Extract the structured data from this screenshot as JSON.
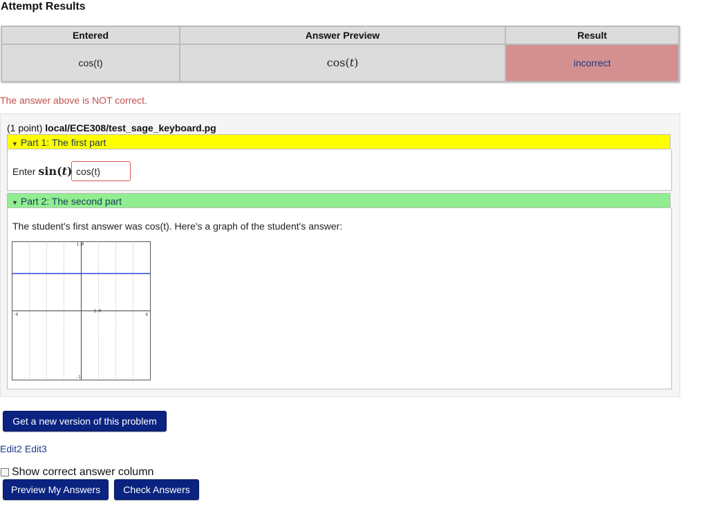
{
  "title": "Attempt Results",
  "results": {
    "headers": [
      "Entered",
      "Answer Preview",
      "Result"
    ],
    "row": {
      "entered": "cos(t)",
      "preview_func": "cos",
      "preview_var": "t",
      "result": "incorrect"
    }
  },
  "feedback": "The answer above is NOT correct.",
  "problem": {
    "points": "(1 point)",
    "path": "local/ECE308/test_sage_keyboard.pg",
    "part1": {
      "header": "Part 1: The first part",
      "enter_label": "Enter",
      "math_func": "sin",
      "math_var": "t",
      "input_value": "cos(t)"
    },
    "part2": {
      "header": "Part 2: The second part",
      "text": "The student's first answer was cos(t). Here's a graph of the student's answer:"
    }
  },
  "chart_data": {
    "type": "line",
    "series": [
      {
        "x": [
          -4,
          4
        ],
        "values": [
          0.54,
          0.54
        ]
      }
    ],
    "xlim": [
      -4,
      4
    ],
    "ylim": [
      -1,
      1
    ],
    "tick_labels": {
      "y_top": "1.0",
      "y_bottom": "-1",
      "x_left": "-4",
      "x_right": "4",
      "origin": "1.0"
    },
    "grid": true,
    "line_color": "#2b3fd6"
  },
  "buttons": {
    "new_version": "Get a new version of this problem",
    "preview": "Preview My Answers",
    "check": "Check Answers"
  },
  "edit_links": [
    "Edit2",
    "Edit3"
  ],
  "show_correct_label": "Show correct answer column"
}
